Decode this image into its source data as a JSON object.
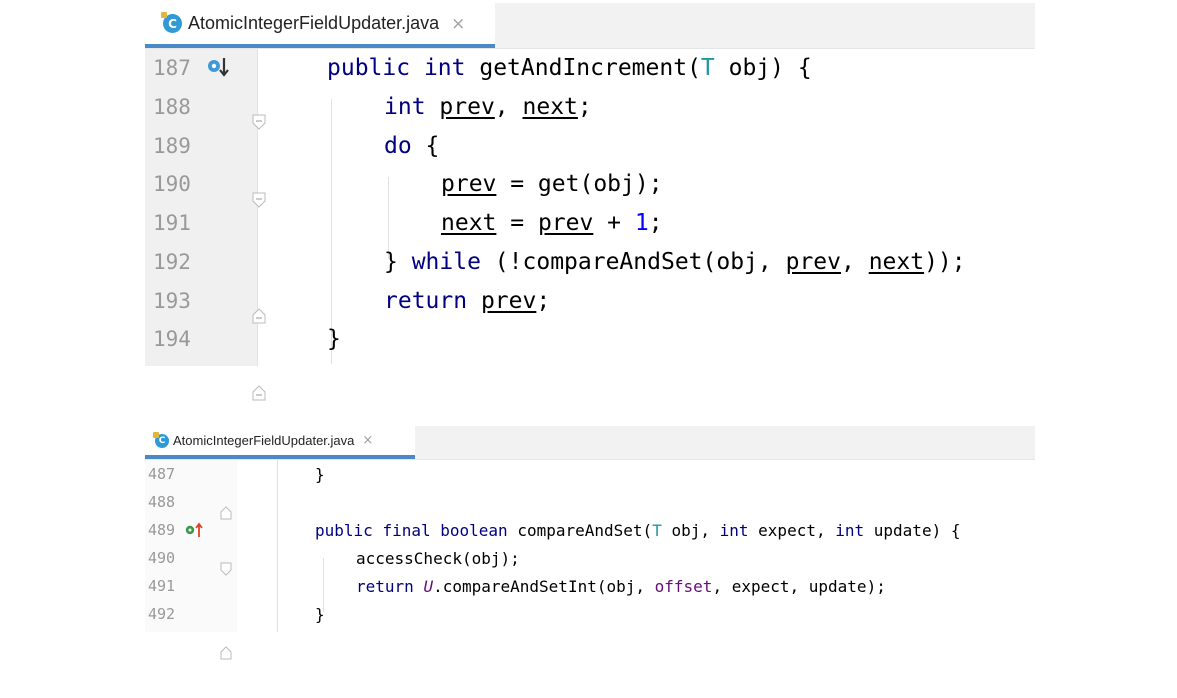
{
  "top_editor": {
    "tab": {
      "filename": "AtomicIntegerFieldUpdater.java",
      "icon": "class-icon",
      "close": "×"
    },
    "lines": [
      {
        "number": "187",
        "marker": "implements-method-icon"
      },
      {
        "number": "188"
      },
      {
        "number": "189"
      },
      {
        "number": "190"
      },
      {
        "number": "191"
      },
      {
        "number": "192"
      },
      {
        "number": "193"
      },
      {
        "number": "194"
      }
    ],
    "code": {
      "l187": {
        "kw_public": "public",
        "kw_int": "int",
        "name": "getAndIncrement(",
        "type_t": "T",
        "rest": " obj) {"
      },
      "l188": {
        "kw_int": "int",
        "var_prev": "prev",
        "comma": ", ",
        "var_next": "next",
        "semi": ";"
      },
      "l189": {
        "kw_do": "do",
        "brace": " {"
      },
      "l190": {
        "var_prev": "prev",
        "rest": " = get(obj);"
      },
      "l191": {
        "var_next": "next",
        "eq": " = ",
        "var_prev": "prev",
        "plus": " + ",
        "num": "1",
        "semi": ";"
      },
      "l192": {
        "close": "} ",
        "kw_while": "while",
        "call": " (!compareAndSet(obj, ",
        "var_prev": "prev",
        "comma": ", ",
        "var_next": "next",
        "end": "));"
      },
      "l193": {
        "kw_return": "return",
        "sp": " ",
        "var_prev": "prev",
        "semi": ";"
      },
      "l194": {
        "close": "}"
      }
    }
  },
  "bottom_editor": {
    "tab": {
      "filename": "AtomicIntegerFieldUpdater.java",
      "icon": "class-icon",
      "close": "×"
    },
    "lines": [
      {
        "number": "487"
      },
      {
        "number": "488"
      },
      {
        "number": "489",
        "marker": "overrides-method-icon"
      },
      {
        "number": "490"
      },
      {
        "number": "491"
      },
      {
        "number": "492"
      }
    ],
    "code": {
      "l487": {
        "close": "}"
      },
      "l489": {
        "kw_public": "public",
        "kw_final": "final",
        "kw_boolean": "boolean",
        "name": " compareAndSet(",
        "type_t": "T",
        "obj": " obj, ",
        "kw_int1": "int",
        "expect": " expect, ",
        "kw_int2": "int",
        "rest": " update) {"
      },
      "l490": {
        "call": "accessCheck(obj);"
      },
      "l491": {
        "kw_return": "return",
        "sp": " ",
        "static_u": "U",
        "call": ".compareAndSetInt(obj, ",
        "field": "offset",
        "rest": ", expect, update);"
      },
      "l492": {
        "close": "}"
      }
    }
  },
  "colors": {
    "keyword": "#000080",
    "type_param": "#20999d",
    "number": "#0000ff",
    "field": "#660e7a",
    "tab_underline": "#4a88c7",
    "line_number": "#999999"
  }
}
